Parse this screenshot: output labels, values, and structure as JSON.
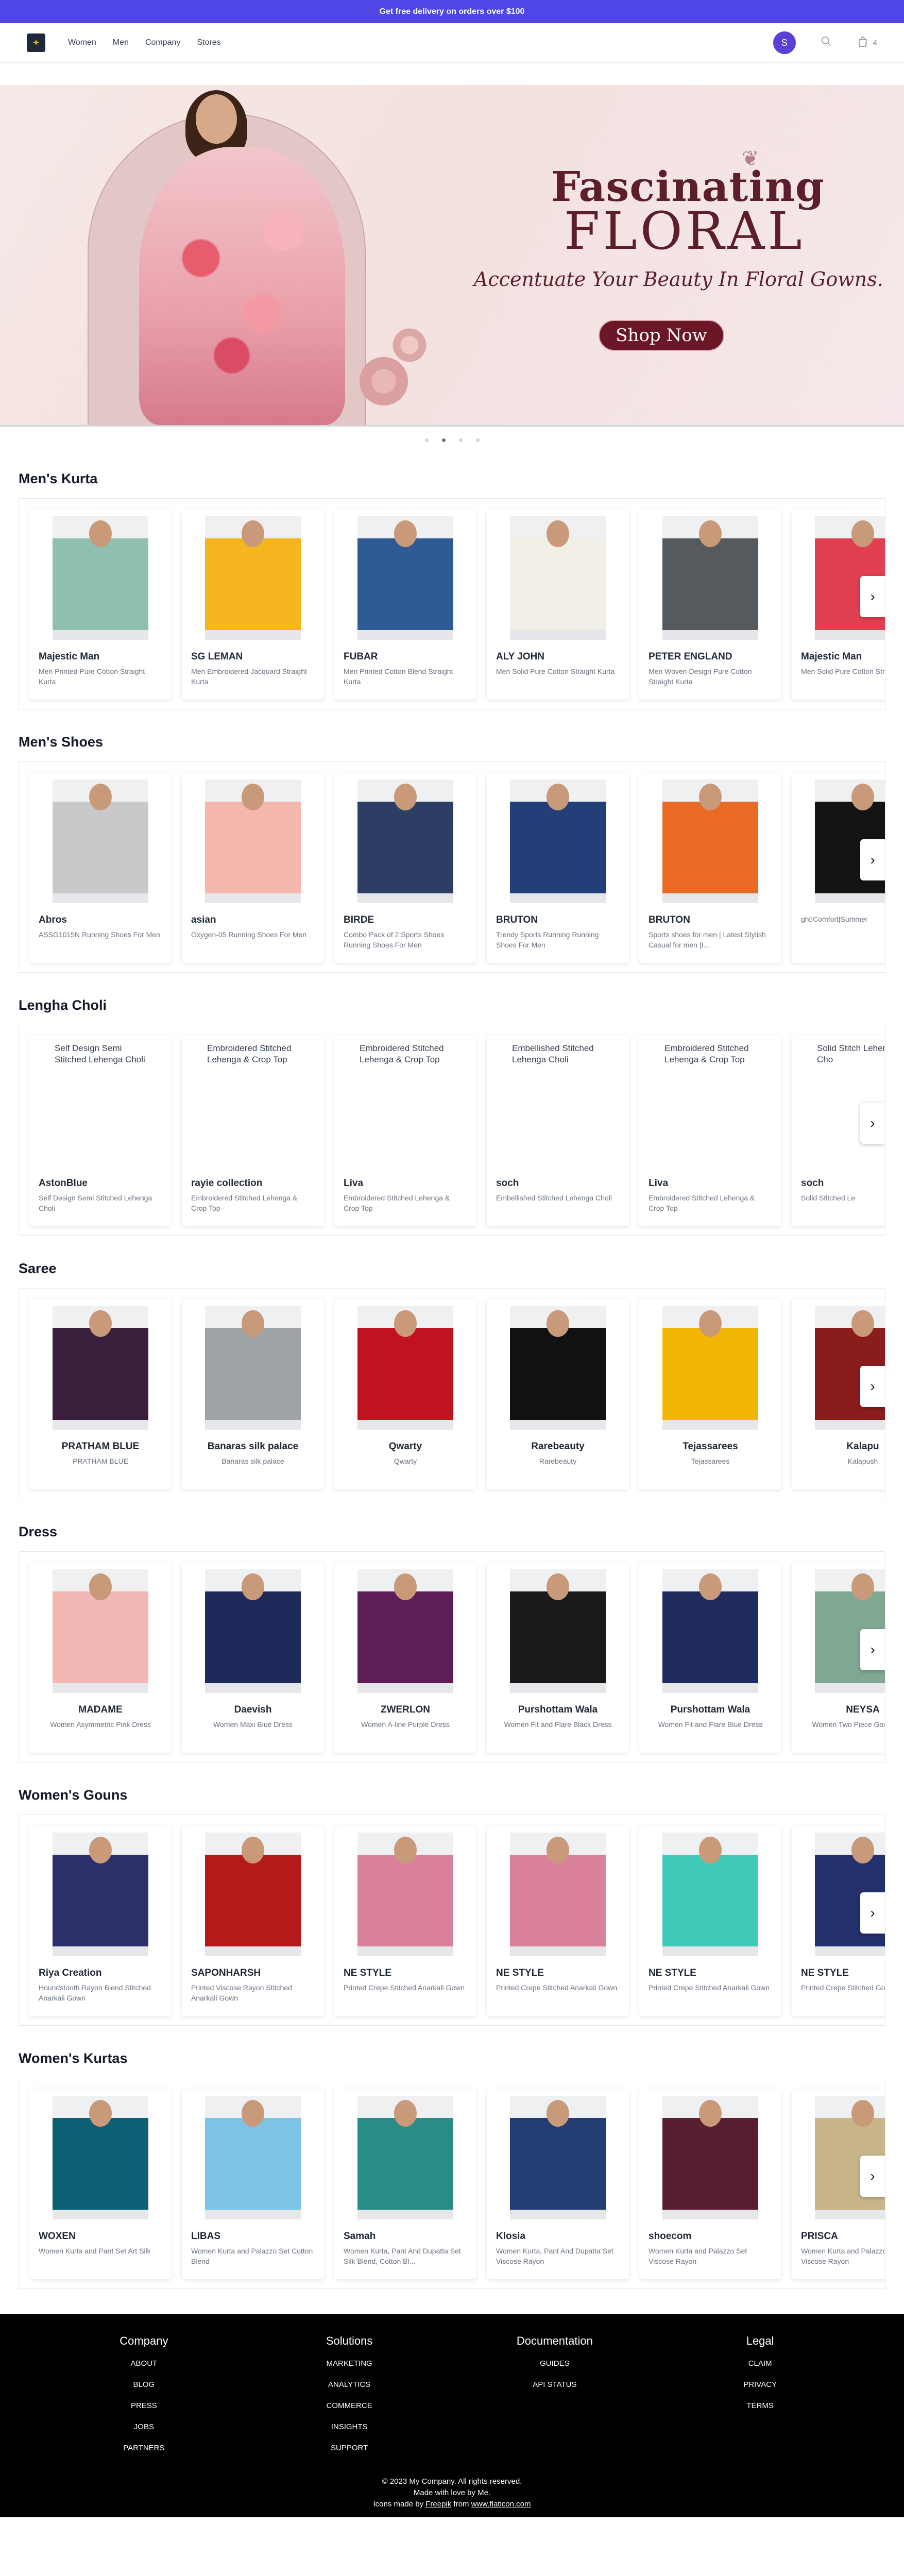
{
  "promo": "Get free delivery on orders over $100",
  "nav": {
    "links": [
      "Women",
      "Men",
      "Company",
      "Stores"
    ],
    "avatar_initial": "S",
    "cart_count": "4"
  },
  "hero": {
    "title_line1": "Fascinating",
    "title_line2": "FLORAL",
    "subtitle": "Accentuate Your Beauty In Floral Gowns.",
    "cta": "Shop Now"
  },
  "sections": [
    {
      "title": "Men's Kurta",
      "items": [
        {
          "brand": "Majestic Man",
          "desc": "Men Printed Pure Cotton Straight Kurta",
          "color": "#8fbfae"
        },
        {
          "brand": "SG LEMAN",
          "desc": "Men Embroidered Jacquard Straight Kurta",
          "color": "#f4b51f"
        },
        {
          "brand": "FUBAR",
          "desc": "Men Printed Cotton Blend Straight Kurta",
          "color": "#2f5b94"
        },
        {
          "brand": "ALY JOHN",
          "desc": "Men Solid Pure Cotton Straight Kurta",
          "color": "#f2f0e6"
        },
        {
          "brand": "PETER ENGLAND",
          "desc": "Men Woven Design Pure Cotton Straight Kurta",
          "color": "#555a5e"
        },
        {
          "brand": "Majestic Man",
          "desc": "Men Solid Pure Cotton Straight Kurta",
          "color": "#e0404f"
        }
      ]
    },
    {
      "title": "Men's Shoes",
      "items": [
        {
          "brand": "Abros",
          "desc": "ASSG1015N Running Shoes For Men",
          "color": "#c9c9cc"
        },
        {
          "brand": "asian",
          "desc": "Oxygen-05 Running Shoes For Men",
          "color": "#f4b7ad"
        },
        {
          "brand": "BIRDE",
          "desc": "Combo Pack of 2 Sports Shoes Running Shoes For Men",
          "color": "#2c3e63"
        },
        {
          "brand": "BRUTON",
          "desc": "Trendy Sports Running Running Shoes For Men",
          "color": "#233f78"
        },
        {
          "brand": "BRUTON",
          "desc": "Sports shoes for men | Latest Stylish Casual for men |I...",
          "color": "#e86a24"
        },
        {
          "brand": "",
          "desc": "ght|Comfort|Summer",
          "color": "#141414"
        }
      ]
    },
    {
      "title": "Lengha Choli",
      "items": [
        {
          "brand": "AstonBlue",
          "desc": "Self Design Semi Stitched Lehenga Choli",
          "alt": "Self Design Semi Stitched Lehenga Choli"
        },
        {
          "brand": "rayie collection",
          "desc": "Embroidered Stitched Lehenga & Crop Top",
          "alt": "Embroidered Stitched Lehenga & Crop Top"
        },
        {
          "brand": "Liva",
          "desc": "Embroidered Stitched Lehenga & Crop Top",
          "alt": "Embroidered Stitched Lehenga & Crop Top"
        },
        {
          "brand": "soch",
          "desc": "Embellished Stitched Lehenga Choli",
          "alt": "Embellished Stitched Lehenga Choli"
        },
        {
          "brand": "Liva",
          "desc": "Embroidered Stitched Lehenga & Crop Top",
          "alt": "Embroidered Stitched Lehenga & Crop Top"
        },
        {
          "brand": "soch",
          "desc": "Solid Stitched Le",
          "alt": "Solid Stitch Lehenga Cho"
        }
      ]
    },
    {
      "title": "Saree",
      "items": [
        {
          "brand": "PRATHAM BLUE",
          "desc": "PRATHAM BLUE",
          "color": "#3a1f3d"
        },
        {
          "brand": "Banaras silk palace",
          "desc": "Banaras silk palace",
          "color": "#9ea3a5"
        },
        {
          "brand": "Qwarty",
          "desc": "Qwarty",
          "color": "#c1121f"
        },
        {
          "brand": "Rarebeauty",
          "desc": "Rarebeauty",
          "color": "#111111"
        },
        {
          "brand": "Tejassarees",
          "desc": "Tejassarees",
          "color": "#f2b705"
        },
        {
          "brand": "Kalapu",
          "desc": "Kalapush",
          "color": "#8a1c1c"
        }
      ]
    },
    {
      "title": "Dress",
      "items": [
        {
          "brand": "MADAME",
          "desc": "Women Asymmetric Pink Dress",
          "color": "#f3b7b4"
        },
        {
          "brand": "Daevish",
          "desc": "Women Maxi Blue Dress",
          "color": "#1e2a5a"
        },
        {
          "brand": "ZWERLON",
          "desc": "Women A-line Purple Dress",
          "color": "#5b1e57"
        },
        {
          "brand": "Purshottam Wala",
          "desc": "Women Fit and Flare Black Dress",
          "color": "#1a1a1a"
        },
        {
          "brand": "Purshottam Wala",
          "desc": "Women Fit and Flare Blue Dress",
          "color": "#1f2b5e"
        },
        {
          "brand": "NEYSA",
          "desc": "Women Two Piece Gown Dress",
          "color": "#7fa892"
        }
      ]
    },
    {
      "title": "Women's Gouns",
      "items": [
        {
          "brand": "Riya Creation",
          "desc": "Houndstooth Rayon Blend Stitched Anarkali Gown",
          "color": "#2d2f6b"
        },
        {
          "brand": "SAPONHARSH",
          "desc": "Printed Viscose Rayon Stitched Anarkali Gown",
          "color": "#b31b1b"
        },
        {
          "brand": "NE STYLE",
          "desc": "Printed Crepe Stitched Anarkali Gown",
          "color": "#d9809a"
        },
        {
          "brand": "NE STYLE",
          "desc": "Printed Crepe Stitched Anarkali Gown",
          "color": "#d9809a"
        },
        {
          "brand": "NE STYLE",
          "desc": "Printed Crepe Stitched Anarkali Gown",
          "color": "#3fc9b7"
        },
        {
          "brand": "NE STYLE",
          "desc": "Printed Crepe Stitched Gown",
          "color": "#24306b"
        }
      ]
    },
    {
      "title": "Women's Kurtas",
      "items": [
        {
          "brand": "WOXEN",
          "desc": "Women Kurta and Pant Set Art Silk",
          "color": "#0d5f73"
        },
        {
          "brand": "LIBAS",
          "desc": "Women Kurta and Palazzo Set Cotton Blend",
          "color": "#7cc3e6"
        },
        {
          "brand": "Samah",
          "desc": "Women Kurta, Pant And Dupatta Set Silk Blend, Cotton Bl...",
          "color": "#2a8c86"
        },
        {
          "brand": "Klosia",
          "desc": "Women Kurta, Pant And Dupatta Set Viscose Rayon",
          "color": "#233d73"
        },
        {
          "brand": "shoecom",
          "desc": "Women Kurta and Palazzo Set Viscose Rayon",
          "color": "#5a1e33"
        },
        {
          "brand": "PRISCA",
          "desc": "Women Kurta and Palazzo Set Viscose Rayon",
          "color": "#c9b58a"
        }
      ]
    }
  ],
  "footer": {
    "columns": [
      {
        "title": "Company",
        "links": [
          "ABOUT",
          "BLOG",
          "PRESS",
          "JOBS",
          "PARTNERS"
        ]
      },
      {
        "title": "Solutions",
        "links": [
          "MARKETING",
          "ANALYTICS",
          "COMMERCE",
          "INSIGHTS",
          "SUPPORT"
        ]
      },
      {
        "title": "Documentation",
        "links": [
          "GUIDES",
          "API STATUS"
        ]
      },
      {
        "title": "Legal",
        "links": [
          "CLAIM",
          "PRIVACY",
          "TERMS"
        ]
      }
    ],
    "copyright": "© 2023 My Company. All rights reserved.",
    "made_with": "Made with love by Me.",
    "icons_prefix": "Icons made by ",
    "icons_author": "Freepik",
    "icons_from": " from ",
    "icons_site": "www.flaticon.com"
  }
}
